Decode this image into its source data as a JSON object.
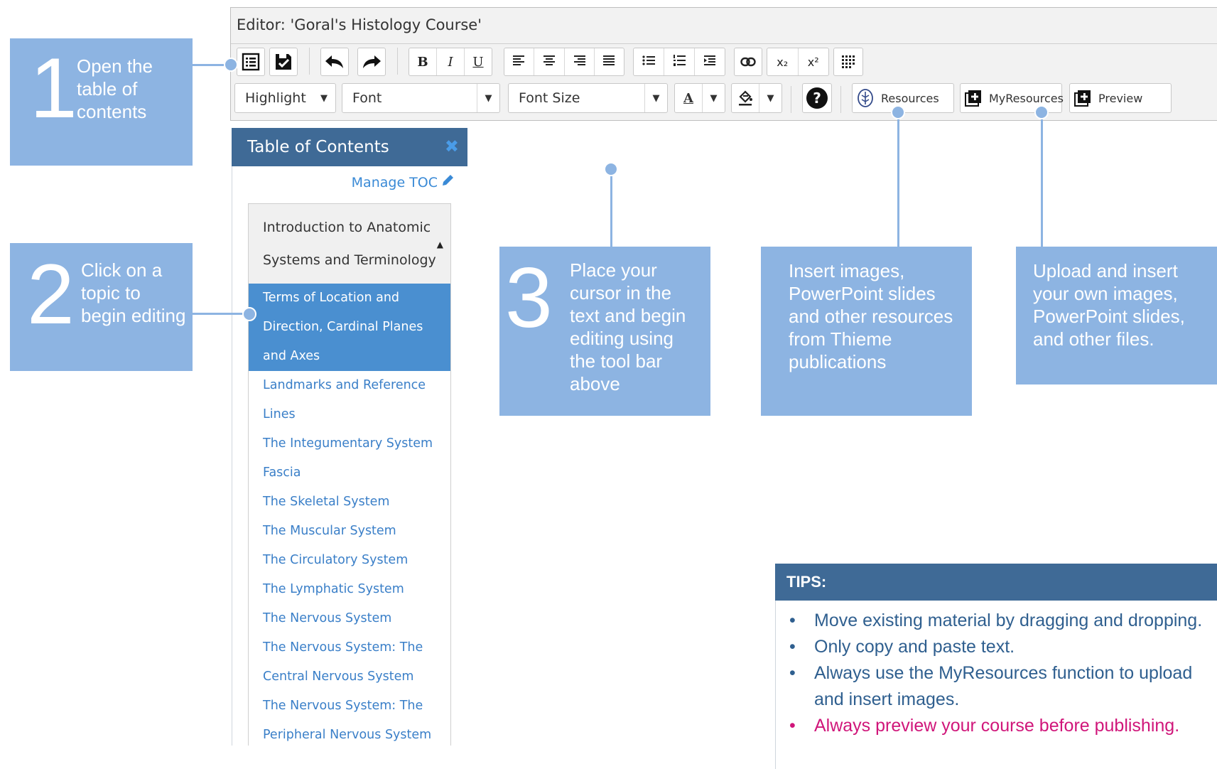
{
  "editor": {
    "title": "Editor: 'Goral's Histology Course'",
    "format_buttons": [
      "B",
      "I",
      "U"
    ],
    "subscript_label": "x₂",
    "superscript_label": "x²",
    "highlight_dropdown": "Highlight",
    "font_dropdown": "Font",
    "font_size_dropdown": "Font Size",
    "font_color_label": "A",
    "help_label": "?",
    "resources_button": "Resources",
    "myresources_button": "MyResources",
    "preview_button": "Preview"
  },
  "toc": {
    "header": "Table of Contents",
    "close_icon": "✖",
    "manage_label": "Manage TOC",
    "parent_item": "Introduction to Anatomic Systems and Terminology",
    "items": [
      {
        "label": "Terms of Location and Direction, Cardinal Planes and Axes",
        "active": true
      },
      {
        "label": "Landmarks and Reference Lines",
        "active": false
      },
      {
        "label": "The Integumentary System",
        "active": false
      },
      {
        "label": "Fascia",
        "active": false
      },
      {
        "label": "The Skeletal System",
        "active": false
      },
      {
        "label": "The Muscular System",
        "active": false
      },
      {
        "label": "The Circulatory System",
        "active": false
      },
      {
        "label": "The Lymphatic System",
        "active": false
      },
      {
        "label": "The Nervous System",
        "active": false
      },
      {
        "label": "The Nervous System: The Central Nervous System",
        "active": false
      },
      {
        "label": "The Nervous System: The Peripheral Nervous System",
        "active": false
      }
    ]
  },
  "callouts": {
    "c1": {
      "number": "1",
      "text": "Open the table of contents"
    },
    "c2": {
      "number": "2",
      "text": "Click on a topic to begin editing"
    },
    "c3": {
      "number": "3",
      "text": "Place your cursor in the text and begin editing using the tool bar above"
    },
    "c4": {
      "text": "Insert images, PowerPoint slides and other resources from Thieme publications"
    },
    "c5": {
      "text": "Upload  and insert your own images, PowerPoint slides, and other files."
    }
  },
  "tips": {
    "header": "TIPS:",
    "items": [
      "Move existing material by dragging and dropping.",
      "Only copy and paste text.",
      "Always use the MyResources function to upload and insert images.",
      "Always preview your course before publishing."
    ]
  },
  "colors": {
    "callout": "#8db4e2",
    "header": "#3f6a96",
    "link": "#3a7fc8",
    "active_item": "#4a8fd0",
    "highlight_tip": "#d0167a"
  }
}
